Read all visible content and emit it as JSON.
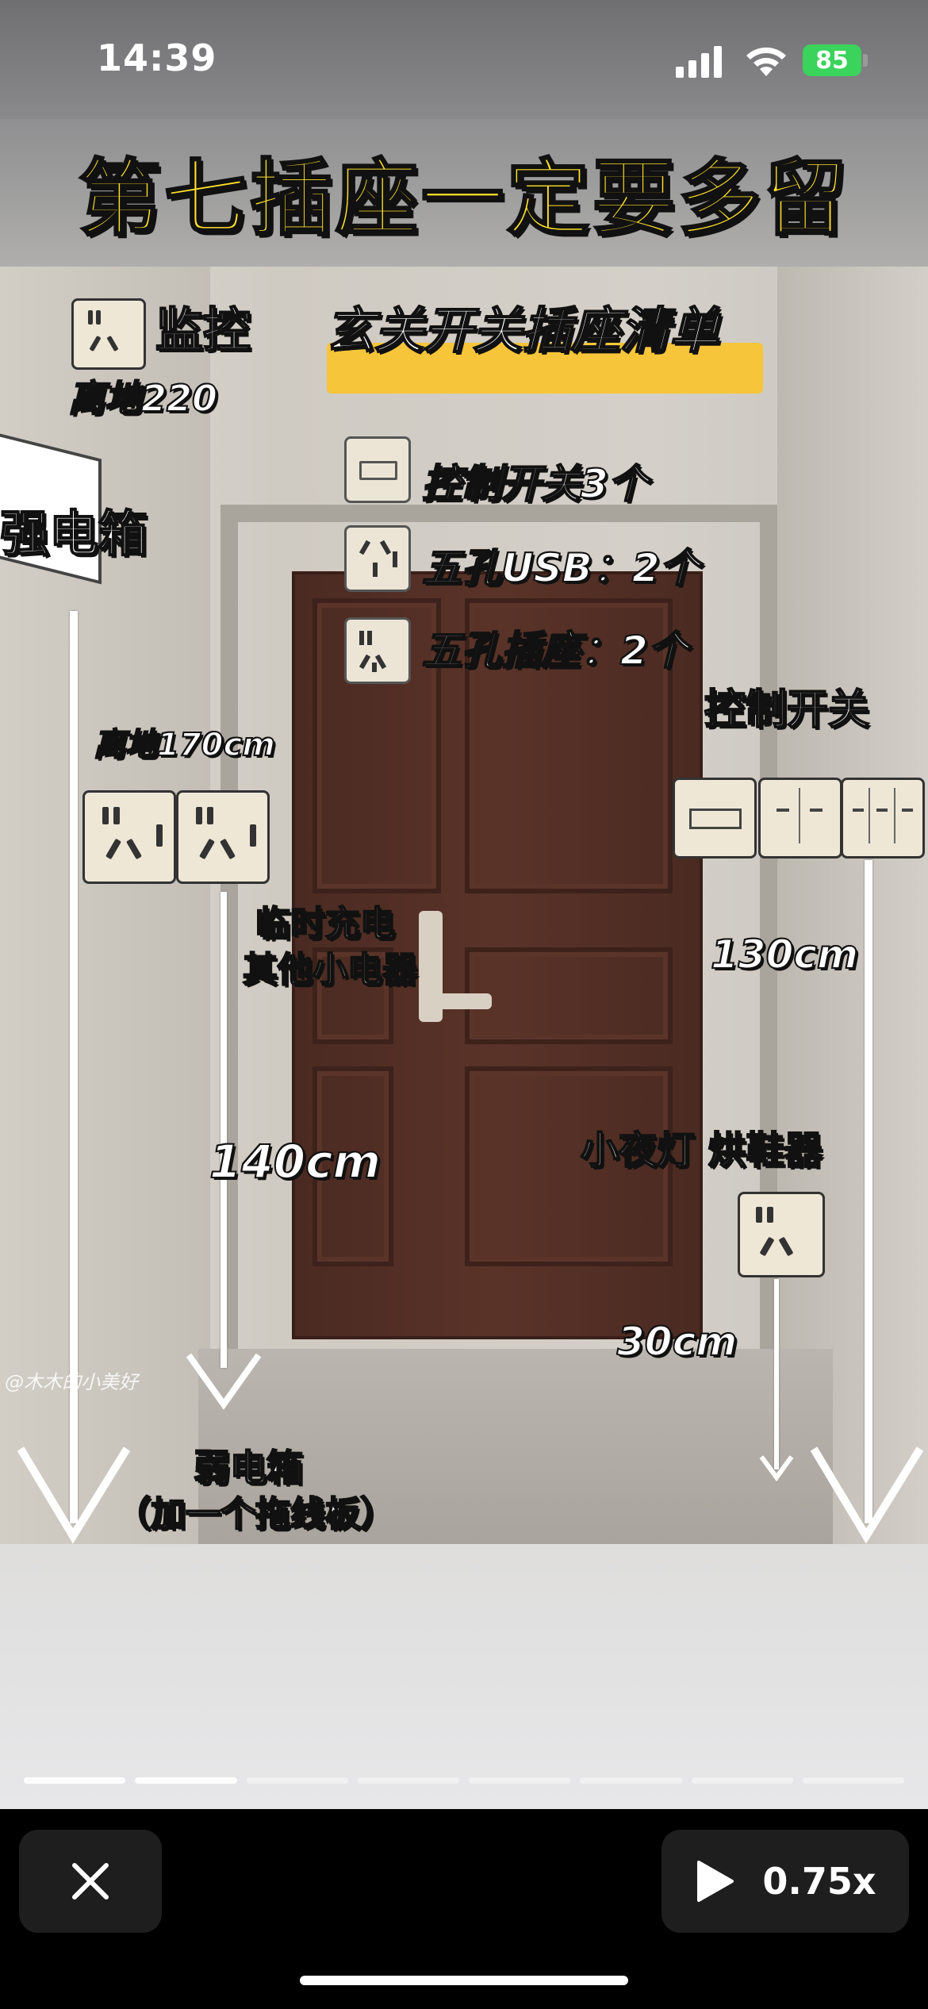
{
  "status_bar": {
    "time": "14:39",
    "battery": "85"
  },
  "video": {
    "header_title": "第七插座一定要多留",
    "list_title": "玄关开关插座清单",
    "list_items": [
      {
        "text": "控制开关3个",
        "icon": "switch-icon"
      },
      {
        "text": "五孔USB：2个",
        "icon": "usb-outlet-icon"
      },
      {
        "text": "五孔插座：2个",
        "icon": "outlet-icon"
      }
    ],
    "labels": {
      "monitor": "监控",
      "monitor_height": "离地220",
      "strong_box": "强电箱",
      "left_height": "离地170cm",
      "temp_charge_line1": "临时充电",
      "temp_charge_line2": "其他小电器",
      "control_switch": "控制开关",
      "right_height": "130cm",
      "left_arrow_len": "140cm",
      "night_light": "小夜灯  烘鞋器",
      "low_outlet_height": "30cm",
      "weak_box": "弱电箱",
      "weak_box_note": "（加一个拖线板）",
      "watermark": "@木木的小美好"
    },
    "progress": {
      "total": 8,
      "active": 2
    }
  },
  "controls": {
    "close_icon": "close-icon",
    "play_icon": "play-icon",
    "speed": "0.75x"
  },
  "colors": {
    "title_yellow": "#ffe12b",
    "highlight": "#f7c53a",
    "battery_green": "#3ad35c"
  }
}
